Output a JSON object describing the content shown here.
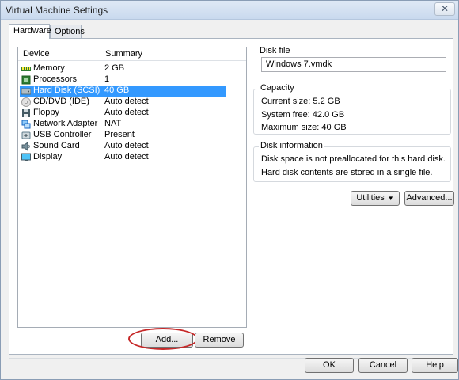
{
  "window": {
    "title": "Virtual Machine Settings",
    "close_glyph": "✕"
  },
  "tabs": [
    {
      "label": "Hardware",
      "active": true
    },
    {
      "label": "Options",
      "active": false
    }
  ],
  "device_list": {
    "columns": {
      "device": "Device",
      "summary": "Summary"
    },
    "items": [
      {
        "device": "Memory",
        "summary": "2 GB",
        "icon": "memory-icon",
        "selected": false
      },
      {
        "device": "Processors",
        "summary": "1",
        "icon": "processor-icon",
        "selected": false
      },
      {
        "device": "Hard Disk (SCSI)",
        "summary": "40 GB",
        "icon": "hard-disk-icon",
        "selected": true
      },
      {
        "device": "CD/DVD (IDE)",
        "summary": "Auto detect",
        "icon": "cd-dvd-icon",
        "selected": false
      },
      {
        "device": "Floppy",
        "summary": "Auto detect",
        "icon": "floppy-icon",
        "selected": false
      },
      {
        "device": "Network Adapter",
        "summary": "NAT",
        "icon": "network-adapter-icon",
        "selected": false
      },
      {
        "device": "USB Controller",
        "summary": "Present",
        "icon": "usb-controller-icon",
        "selected": false
      },
      {
        "device": "Sound Card",
        "summary": "Auto detect",
        "icon": "sound-card-icon",
        "selected": false
      },
      {
        "device": "Display",
        "summary": "Auto detect",
        "icon": "display-icon",
        "selected": false
      }
    ],
    "add_button": "Add...",
    "remove_button": "Remove"
  },
  "disk_file": {
    "label": "Disk file",
    "value": "Windows 7.vmdk"
  },
  "capacity": {
    "label": "Capacity",
    "current_size": "Current size:  5.2 GB",
    "system_free": "System free:  42.0 GB",
    "maximum_size": "Maximum size:  40 GB"
  },
  "disk_information": {
    "label": "Disk information",
    "line1": "Disk space is not preallocated for this hard disk.",
    "line2": "Hard disk contents are stored in a single file."
  },
  "actions": {
    "utilities_button": "Utilities",
    "advanced_button": "Advanced..."
  },
  "footer": {
    "ok_button": "OK",
    "cancel_button": "Cancel",
    "help_button": "Help"
  },
  "colors": {
    "selection": "#3399ff",
    "highlight_ellipse": "#c62828"
  }
}
